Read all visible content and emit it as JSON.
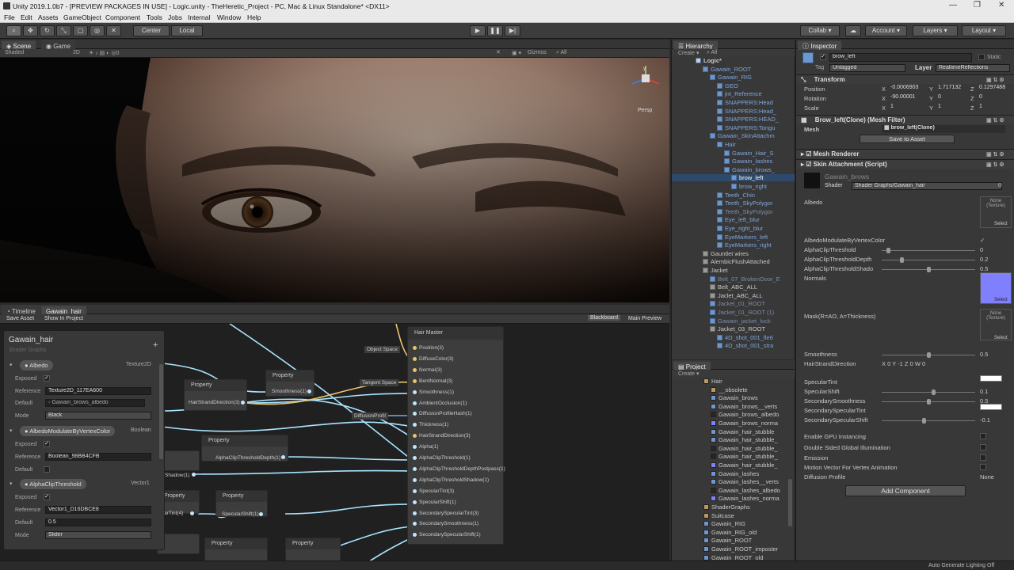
{
  "window": {
    "title": "Unity 2019.1.0b7 - [PREVIEW PACKAGES IN USE] - Logic.unity - TheHeretic_Project - PC, Mac & Linux Standalone* <DX11>"
  },
  "menu": [
    "File",
    "Edit",
    "Assets",
    "GameObject",
    "Component",
    "Tools",
    "Jobs",
    "Internal",
    "Window",
    "Help"
  ],
  "toolbar": {
    "pivot": "Center",
    "space": "Local",
    "collab": "Collab",
    "account": "Account",
    "layers": "Layers",
    "layout": "Layout"
  },
  "scene": {
    "tabs": [
      "Scene",
      "Game"
    ],
    "shading": "Shaded",
    "mode_2d": "2D",
    "gizmos": "Gizmos",
    "search": "All",
    "persp": "Persp"
  },
  "timeline": {
    "tabs": [
      "Timeline",
      "Gawain_hair"
    ],
    "save": "Save Asset",
    "show": "Show In Project",
    "blackboard": "Blackboard",
    "main_preview": "Main Preview"
  },
  "blackboard": {
    "title": "Gawain_hair",
    "subtitle": "Shader Graphs",
    "props": [
      {
        "name": "Albedo",
        "type": "Texture2D",
        "exposed_label": "Exposed",
        "ref_label": "Reference",
        "ref": "Texture2D_117EA600",
        "def_label": "Default",
        "def": "Gawain_brows_albedo",
        "mode_label": "Mode",
        "mode": "Black"
      },
      {
        "name": "AlbedoModulateByVertexColor",
        "type": "Boolean",
        "exposed_label": "Exposed",
        "ref_label": "Reference",
        "ref": "Boolean_98BB4CFB",
        "def_label": "Default"
      },
      {
        "name": "AlphaClipThreshold",
        "type": "Vector1",
        "exposed_label": "Exposed",
        "ref_label": "Reference",
        "ref": "Vector1_D16DBCE8",
        "def_label": "Default",
        "def": "0.5",
        "mode_label": "Mode",
        "mode": "Slider"
      }
    ]
  },
  "graph": {
    "property_nodes": [
      "Property",
      "Property",
      "Property",
      "Property",
      "Property",
      "Property",
      "Property",
      "Property",
      "Property"
    ],
    "pills": [
      "HairStrandDirection(3)",
      "Smoothness(1)",
      "AlphaClipThresholdDepth(1)",
      "Shadow(1)",
      "ularTint(4)",
      "SpecularShift(1)",
      "Object Space",
      "Tangent Space",
      "DiffusionProfil"
    ],
    "master": {
      "title": "Hair Master",
      "ports": [
        "Position(3)",
        "DiffuseColor(3)",
        "Normal(3)",
        "BentNormal(3)",
        "Smoothness(1)",
        "AmbientOcclusion(1)",
        "DiffusionProfileHash(1)",
        "Thickness(1)",
        "HairStrandDirection(3)",
        "Alpha(1)",
        "AlphaClipThreshold(1)",
        "AlphaClipThresholdDepthPostpass(1)",
        "AlphaClipThresholdShadow(1)",
        "SpecularTint(3)",
        "SpecularShift(1)",
        "SecondarySpecularTint(3)",
        "SecondarySmoothness(1)",
        "SecondarySpecularShift(1)"
      ]
    }
  },
  "hierarchy": {
    "tab": "Hierarchy",
    "create": "Create",
    "search": "All",
    "items": [
      {
        "label": "Logic*",
        "depth": 0,
        "style": "scene"
      },
      {
        "label": "Gawain_ROOT",
        "depth": 1,
        "style": "blue"
      },
      {
        "label": "Gawain_RIG",
        "depth": 2,
        "style": "blue"
      },
      {
        "label": "GEO",
        "depth": 3,
        "style": "blue"
      },
      {
        "label": "jnt_Reference",
        "depth": 3,
        "style": "blue"
      },
      {
        "label": "SNAPPERS:Head",
        "depth": 3,
        "style": "blue"
      },
      {
        "label": "SNAPPERS:Head_",
        "depth": 3,
        "style": "blue"
      },
      {
        "label": "SNAPPERS:HEAD_",
        "depth": 3,
        "style": "blue"
      },
      {
        "label": "SNAPPERS:Tongu",
        "depth": 3,
        "style": "blue"
      },
      {
        "label": "Gawain_SkinAttachm",
        "depth": 2,
        "style": "blue"
      },
      {
        "label": "Hair",
        "depth": 3,
        "style": "blue"
      },
      {
        "label": "Gawain_Hair_S",
        "depth": 4,
        "style": "blue"
      },
      {
        "label": "Gawain_lashes",
        "depth": 4,
        "style": "blue"
      },
      {
        "label": "Gawain_brows_",
        "depth": 4,
        "style": "blue"
      },
      {
        "label": "brow_left",
        "depth": 5,
        "style": "sel"
      },
      {
        "label": "brow_right",
        "depth": 5,
        "style": "blue"
      },
      {
        "label": "Teeth_Chin",
        "depth": 3,
        "style": "blue"
      },
      {
        "label": "Teeth_SkyPolygor",
        "depth": 3,
        "style": "blue"
      },
      {
        "label": "Teeth_SkyPolygor",
        "depth": 3,
        "style": "dim"
      },
      {
        "label": "Eye_left_blur",
        "depth": 3,
        "style": "blue"
      },
      {
        "label": "Eye_right_blur",
        "depth": 3,
        "style": "blue"
      },
      {
        "label": "EyeMarkers_left",
        "depth": 3,
        "style": "blue"
      },
      {
        "label": "EyeMarkers_right",
        "depth": 3,
        "style": "blue"
      },
      {
        "label": "Gauntlet wires",
        "depth": 1,
        "style": "plain"
      },
      {
        "label": "AlembicFlushAttached",
        "depth": 1,
        "style": "plain"
      },
      {
        "label": "Jacket",
        "depth": 1,
        "style": "plain"
      },
      {
        "label": "Belt_07_BrokenDoor_E",
        "depth": 2,
        "style": "dim"
      },
      {
        "label": "Belt_ABC_ALL",
        "depth": 2,
        "style": "plain"
      },
      {
        "label": "Jaclet_ABC_ALL",
        "depth": 2,
        "style": "plain"
      },
      {
        "label": "Jacket_01_ROOT",
        "depth": 2,
        "style": "dim"
      },
      {
        "label": "Jacket_01_ROOT (1)",
        "depth": 2,
        "style": "dim"
      },
      {
        "label": "Gawain_jacket_lock",
        "depth": 2,
        "style": "dim"
      },
      {
        "label": "Jacket_03_ROOT",
        "depth": 2,
        "style": "plain"
      },
      {
        "label": "4D_shot_001_fle6",
        "depth": 3,
        "style": "blue"
      },
      {
        "label": "4D_shot_001_stra",
        "depth": 3,
        "style": "blue"
      }
    ]
  },
  "project": {
    "tab": "Project",
    "create": "Create",
    "items": [
      {
        "label": "Hair",
        "depth": 0,
        "icon": "folder"
      },
      {
        "label": "__obsolete",
        "depth": 1,
        "icon": "folder"
      },
      {
        "label": "Gawain_brows",
        "depth": 1,
        "icon": "model"
      },
      {
        "label": "Gawain_brows__verts",
        "depth": 1,
        "icon": "model"
      },
      {
        "label": "Gawain_brows_albedo",
        "depth": 1,
        "icon": "tex-dark"
      },
      {
        "label": "Gawain_brows_norma",
        "depth": 1,
        "icon": "tex-blue"
      },
      {
        "label": "Gawain_hair_stubble",
        "depth": 1,
        "icon": "model"
      },
      {
        "label": "Gawain_hair_stubble_",
        "depth": 1,
        "icon": "model"
      },
      {
        "label": "Gawain_hair_stubble_",
        "depth": 1,
        "icon": "tex-dark"
      },
      {
        "label": "Gawain_hair_stubble_",
        "depth": 1,
        "icon": "tex-dark"
      },
      {
        "label": "Gawain_hair_stubble_",
        "depth": 1,
        "icon": "tex-blue"
      },
      {
        "label": "Gawain_lashes",
        "depth": 1,
        "icon": "model"
      },
      {
        "label": "Gawain_lashes__verts",
        "depth": 1,
        "icon": "model"
      },
      {
        "label": "Gawain_lashes_albedo",
        "depth": 1,
        "icon": "tex-dark"
      },
      {
        "label": "Gawain_lashes_norma",
        "depth": 1,
        "icon": "tex-blue"
      },
      {
        "label": "ShaderGraphs",
        "depth": 0,
        "icon": "folder"
      },
      {
        "label": "Suitcase",
        "depth": 0,
        "icon": "folder"
      },
      {
        "label": "Gawain_RIG",
        "depth": 0,
        "icon": "model"
      },
      {
        "label": "Gawain_RIG_old",
        "depth": 0,
        "icon": "model"
      },
      {
        "label": "Gawain_ROOT",
        "depth": 0,
        "icon": "model"
      },
      {
        "label": "Gawain_ROOT_imposter",
        "depth": 0,
        "icon": "model"
      },
      {
        "label": "Gawain_ROOT_old",
        "depth": 0,
        "icon": "model"
      }
    ]
  },
  "inspector": {
    "tab": "Inspector",
    "object_name": "brow_left",
    "static_label": "Static",
    "tag_label": "Tag",
    "tag": "Untagged",
    "layer_label": "Layer",
    "layer": "RealtimeReflections",
    "transform": {
      "title": "Transform",
      "position_label": "Position",
      "position": [
        "-0.0006903",
        "1.717132",
        "0.1297488"
      ],
      "rotation_label": "Rotation",
      "rotation": [
        "-90.00001",
        "0",
        "0"
      ],
      "scale_label": "Scale",
      "scale": [
        "1",
        "1",
        "1"
      ]
    },
    "mesh_filter": {
      "title": "Brow_left(Clone) (Mesh Filter)",
      "mesh_label": "Mesh",
      "mesh": "brow_left(Clone)",
      "save": "Save to Asset"
    },
    "mesh_renderer": "Mesh Renderer",
    "skin_attachment": "Skin Attachment (Script)",
    "material": {
      "name": "Gawain_brows",
      "shader_label": "Shader",
      "shader": "Shader Graphs/Gawain_hair"
    },
    "props": [
      {
        "label": "Albedo"
      },
      {
        "label": "AlbedoModulateByVertexColor",
        "value": "✓"
      },
      {
        "label": "AlphaClipThreshold",
        "value": "0"
      },
      {
        "label": "AlphaClipThresholdDepth",
        "value": "0.2"
      },
      {
        "label": "AlphaClipThresholdShado",
        "value": "0.5"
      },
      {
        "label": "Normals"
      },
      {
        "label": "Mask(R=AO, A=Thickness)"
      },
      {
        "label": "Smoothness",
        "value": "0.5"
      },
      {
        "label": "HairStrandDirection",
        "value": "X 0   Y -1   Z 0   W 0"
      },
      {
        "label": "SpecularTint"
      },
      {
        "label": "SpecularShift",
        "value": "0.1"
      },
      {
        "label": "SecondarySmoothness",
        "value": "0.5"
      },
      {
        "label": "SecondarySpecularTint"
      },
      {
        "label": "SecondarySpecularShift",
        "value": "-0.1"
      },
      {
        "label": "Enable GPU Instancing"
      },
      {
        "label": "Double Sided Global Illumination"
      },
      {
        "label": "Emission"
      },
      {
        "label": "Motion Vector For Vertex Animation"
      },
      {
        "label": "Diffusion Profile",
        "value": "None"
      }
    ],
    "tex_none": "None\n(Texture)",
    "select": "Select",
    "add_component": "Add Component"
  },
  "statusbar": {
    "text": "Auto Generate Lighting Off"
  },
  "colors": {
    "accent": "#3d6aa3",
    "selection": "#2d4a6c",
    "normal_map": "#8080ff",
    "wire": "#a9e4ff"
  }
}
